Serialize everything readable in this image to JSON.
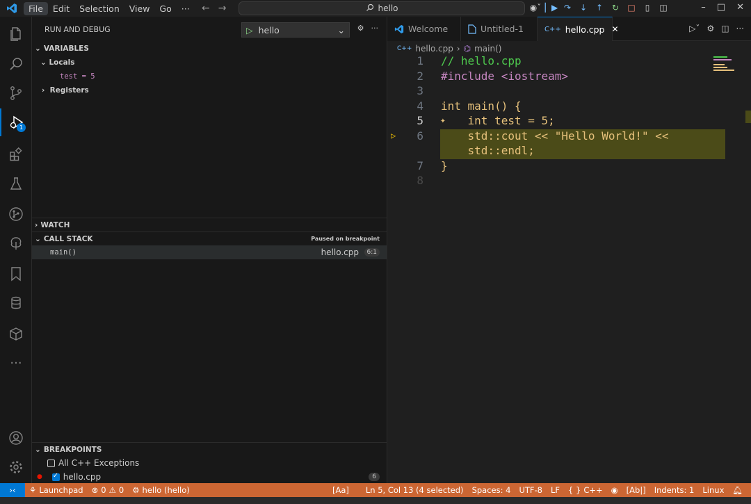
{
  "menubar": {
    "items": [
      "File",
      "Edit",
      "Selection",
      "View",
      "Go",
      "···"
    ],
    "search_text": "hello"
  },
  "sidebar": {
    "title": "RUN AND DEBUG",
    "launch_config": "hello",
    "variables": {
      "header": "VARIABLES",
      "locals_label": "Locals",
      "local_var": "test = 5",
      "registers_label": "Registers"
    },
    "watch": {
      "header": "WATCH"
    },
    "call_stack": {
      "header": "CALL STACK",
      "status": "Paused on breakpoint",
      "frame_name": "main()",
      "frame_file": "hello.cpp",
      "frame_pos": "6:1"
    },
    "breakpoints": {
      "header": "BREAKPOINTS",
      "items": [
        {
          "label": "All C++ Exceptions",
          "checked": false,
          "dot": false,
          "count": ""
        },
        {
          "label": "hello.cpp",
          "checked": true,
          "dot": true,
          "count": "6"
        }
      ]
    }
  },
  "activity_badge": "1",
  "editor": {
    "tabs": [
      {
        "label": "Welcome",
        "active": false
      },
      {
        "label": "Untitled-1",
        "active": false
      },
      {
        "label": "hello.cpp",
        "active": true
      }
    ],
    "breadcrumb": {
      "file": "hello.cpp",
      "symbol": "main()"
    },
    "lines": [
      {
        "n": "1",
        "text": "// hello.cpp"
      },
      {
        "n": "2",
        "text": "#include <iostream>"
      },
      {
        "n": "3",
        "text": ""
      },
      {
        "n": "4",
        "text": "int main() {"
      },
      {
        "n": "5",
        "text": "    int test = 5;"
      },
      {
        "n": "6",
        "text": "    std::cout << \"Hello World!\" <<"
      },
      {
        "n": "",
        "text": "    std::endl;"
      },
      {
        "n": "7",
        "text": "}"
      },
      {
        "n": "8",
        "text": ""
      }
    ]
  },
  "statusbar": {
    "launchpad": "Launchpad",
    "errors": "0",
    "warnings": "0",
    "debug_target": "hello (hello)",
    "aa": "[Aa]",
    "position": "Ln 5, Col 13 (4 selected)",
    "spaces": "Spaces: 4",
    "encoding": "UTF-8",
    "eol": "LF",
    "language": "C++",
    "ab": "[Ab|]",
    "indents": "Indents: 1",
    "os": "Linux"
  },
  "colors": {
    "accent": "#0078d4",
    "statusbar": "#cc6633",
    "debug_line_bg": "#4b4b18",
    "keyword": "#e5c07b",
    "comment": "#4ec94e",
    "string": "#ce9178"
  }
}
